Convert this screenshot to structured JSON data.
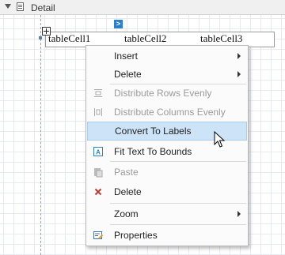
{
  "band": {
    "title": "Detail"
  },
  "table": {
    "cells": [
      "tableCell1",
      "tableCell2",
      "tableCell3"
    ]
  },
  "smart_tag": {
    "glyph": ">"
  },
  "menu": {
    "items": [
      {
        "label": "Insert",
        "icon": "none",
        "submenu": true,
        "disabled": false
      },
      {
        "label": "Delete",
        "icon": "none",
        "submenu": true,
        "disabled": false
      },
      {
        "label": "Distribute Rows Evenly",
        "icon": "distribute-rows-icon",
        "submenu": false,
        "disabled": true
      },
      {
        "label": "Distribute Columns Evenly",
        "icon": "distribute-columns-icon",
        "submenu": false,
        "disabled": true
      },
      {
        "label": "Convert To Labels",
        "icon": "none",
        "submenu": false,
        "disabled": false,
        "highlighted": true
      },
      {
        "label": "Fit Text To Bounds",
        "icon": "fit-text-icon",
        "submenu": false,
        "disabled": false
      },
      {
        "label": "Paste",
        "icon": "paste-icon",
        "submenu": false,
        "disabled": true
      },
      {
        "label": "Delete",
        "icon": "delete-icon",
        "submenu": false,
        "disabled": false
      },
      {
        "label": "Zoom",
        "icon": "none",
        "submenu": true,
        "disabled": false
      },
      {
        "label": "Properties",
        "icon": "properties-icon",
        "submenu": false,
        "disabled": false
      }
    ]
  },
  "colors": {
    "highlight": "#cde3f7",
    "delete_icon": "#c0392b",
    "accent": "#2c7fc9"
  }
}
